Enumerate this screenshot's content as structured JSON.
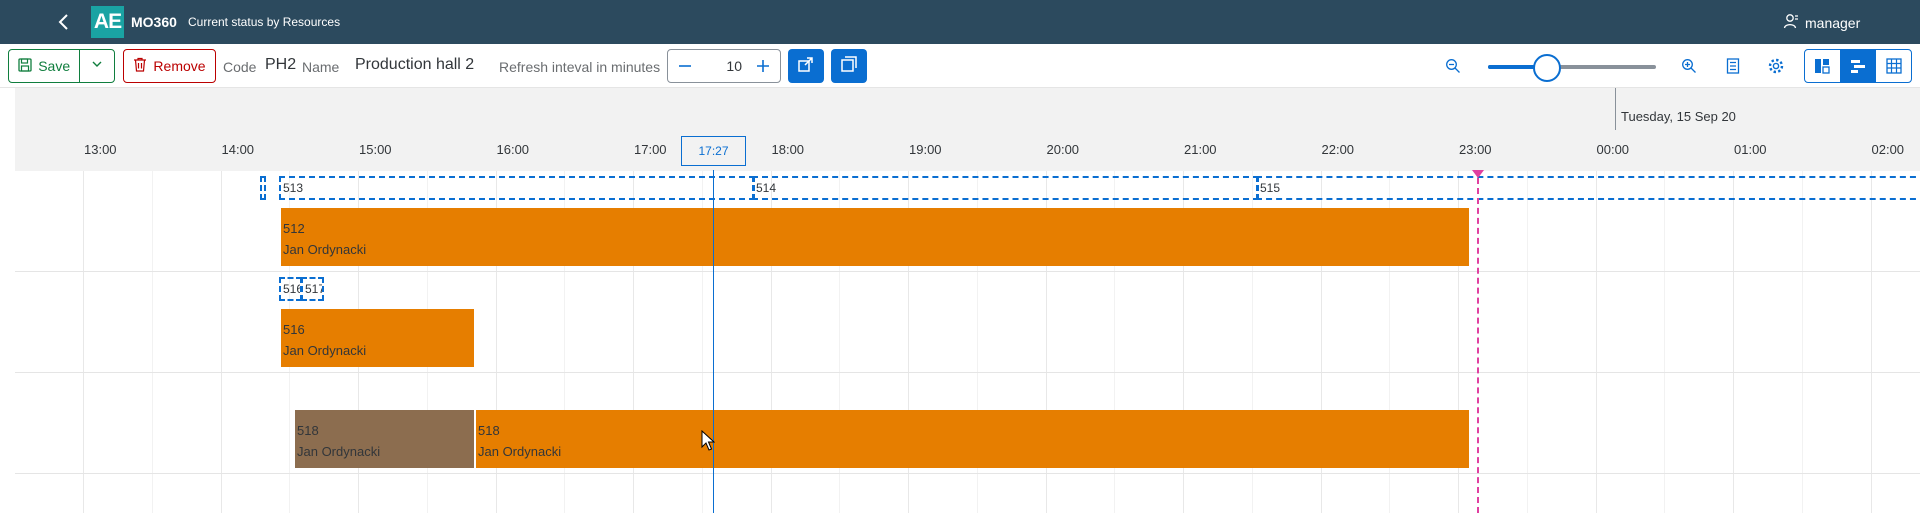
{
  "shell": {
    "logo_text": "AE",
    "app_name": "MO360",
    "app_subtitle": "Current status by Resources",
    "user": "manager"
  },
  "toolbar": {
    "save_label": "Save",
    "remove_label": "Remove",
    "code_label": "Code",
    "code_value": "PH2",
    "name_label": "Name",
    "name_value": "Production hall 2",
    "refresh_label": "Refresh inteval in minutes",
    "refresh_value": "10",
    "zoom_level": 0.35
  },
  "gantt": {
    "date_label": "Tuesday, 15 Sep 20",
    "time_labels": [
      "13:00",
      "14:00",
      "15:00",
      "16:00",
      "17:00",
      "18:00",
      "19:00",
      "20:00",
      "21:00",
      "22:00",
      "23:00",
      "00:00",
      "01:00",
      "02:00"
    ],
    "now_time": "17:27",
    "rows": [
      {
        "placeholders": [
          "",
          "513",
          "514",
          "515"
        ],
        "tasks": [
          {
            "id": "512",
            "person": "Jan Ordynacki",
            "color": "#e67e00"
          }
        ]
      },
      {
        "placeholders": [
          "516",
          "517"
        ],
        "tasks": [
          {
            "id": "516",
            "person": "Jan Ordynacki",
            "color": "#e67e00"
          }
        ]
      },
      {
        "placeholders": [],
        "tasks": [
          {
            "id": "518",
            "person": "Jan Ordynacki",
            "color": "#8c6d4f"
          },
          {
            "id": "518",
            "person": "Jan Ordynacki",
            "color": "#e67e00"
          }
        ]
      }
    ]
  },
  "colors": {
    "shell_bg": "#2c4a5e",
    "accent": "#0a6ed1",
    "task_orange": "#e67e00",
    "task_brown": "#8c6d4f",
    "marker": "#e040a0"
  }
}
